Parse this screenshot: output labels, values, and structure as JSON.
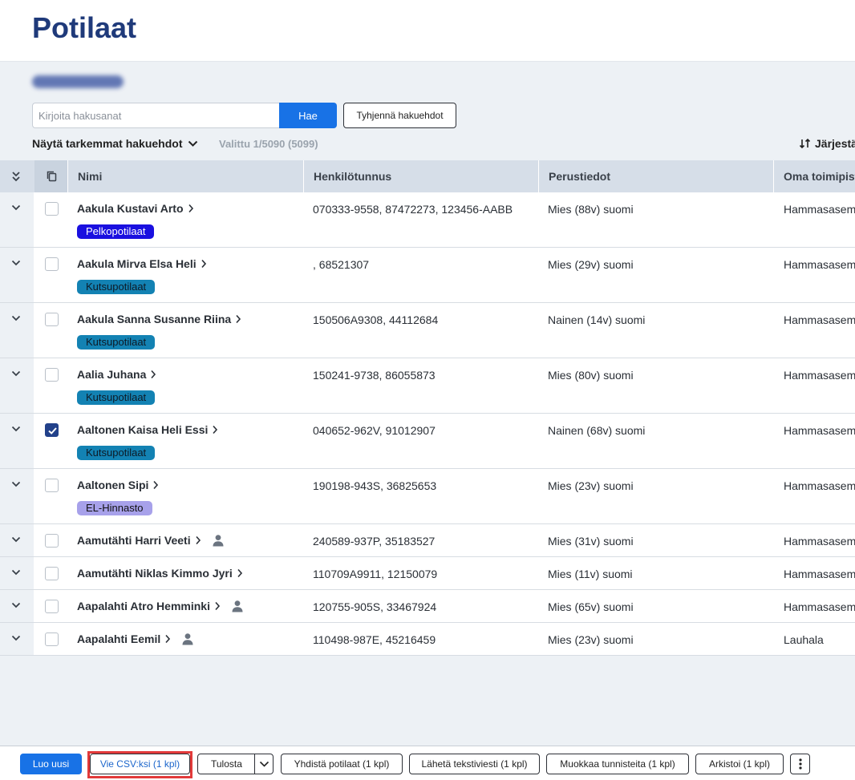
{
  "page": {
    "title": "Potilaat"
  },
  "search": {
    "placeholder": "Kirjoita hakusanat",
    "value": "",
    "search_label": "Hae",
    "clear_label": "Tyhjennä hakuehdot"
  },
  "filters": {
    "more_label": "Näytä tarkemmat hakuehdot",
    "selected_count": "Valittu 1/5090 (5099)",
    "sort_label": "Järjestä"
  },
  "table": {
    "headers": {
      "name": "Nimi",
      "hetu": "Henkilötunnus",
      "basic": "Perustiedot",
      "office": "Oma toimipiste"
    },
    "rows": [
      {
        "name": "Aakula Kustavi Arto",
        "hetu": "070333-9558, 87472273, 123456-AABB",
        "basic": "Mies (88v) suomi",
        "office": "Hammasasema",
        "tag": "Pelkopotilaat",
        "tag_style": "pelko",
        "checked": false,
        "person": false
      },
      {
        "name": "Aakula Mirva Elsa Heli",
        "hetu": ", 68521307",
        "basic": "Mies (29v) suomi",
        "office": "Hammasasema",
        "tag": "Kutsupotilaat",
        "tag_style": "kutsu",
        "checked": false,
        "person": false
      },
      {
        "name": "Aakula Sanna Susanne Riina",
        "hetu": "150506A9308, 44112684",
        "basic": "Nainen (14v) suomi",
        "office": "Hammasasema",
        "tag": "Kutsupotilaat",
        "tag_style": "kutsu",
        "checked": false,
        "person": false
      },
      {
        "name": "Aalia Juhana",
        "hetu": "150241-9738, 86055873",
        "basic": "Mies (80v) suomi",
        "office": "Hammasasema",
        "tag": "Kutsupotilaat",
        "tag_style": "kutsu",
        "checked": false,
        "person": false
      },
      {
        "name": "Aaltonen Kaisa Heli Essi",
        "hetu": "040652-962V, 91012907",
        "basic": "Nainen (68v) suomi",
        "office": "Hammasasema",
        "tag": "Kutsupotilaat",
        "tag_style": "kutsu",
        "checked": true,
        "person": false
      },
      {
        "name": "Aaltonen Sipi",
        "hetu": "190198-943S, 36825653",
        "basic": "Mies (23v) suomi",
        "office": "Hammasasema",
        "tag": "EL-Hinnasto",
        "tag_style": "el",
        "checked": false,
        "person": false
      },
      {
        "name": "Aamutähti Harri Veeti",
        "hetu": "240589-937P, 35183527",
        "basic": "Mies (31v) suomi",
        "office": "Hammasasema",
        "tag": "",
        "tag_style": "",
        "checked": false,
        "person": true
      },
      {
        "name": "Aamutähti Niklas Kimmo Jyri",
        "hetu": "110709A9911, 12150079",
        "basic": "Mies (11v) suomi",
        "office": "Hammasasema",
        "tag": "",
        "tag_style": "",
        "checked": false,
        "person": false
      },
      {
        "name": "Aapalahti Atro Hemminki",
        "hetu": "120755-905S, 33467924",
        "basic": "Mies (65v) suomi",
        "office": "Hammasasema",
        "tag": "",
        "tag_style": "",
        "checked": false,
        "person": true
      },
      {
        "name": "Aapalahti Eemil",
        "hetu": "110498-987E, 45216459",
        "basic": "Mies (23v) suomi",
        "office": "Lauhala",
        "tag": "",
        "tag_style": "",
        "checked": false,
        "person": true
      }
    ]
  },
  "actions": {
    "new": "Luo uusi",
    "csv": "Vie CSV:ksi (1 kpl)",
    "print": "Tulosta",
    "merge": "Yhdistä potilaat (1 kpl)",
    "sms": "Lähetä tekstiviesti (1 kpl)",
    "edit_ids": "Muokkaa tunnisteita (1 kpl)",
    "archive": "Arkistoi (1 kpl)"
  },
  "colors": {
    "title": "#1f3a7a",
    "primary": "#1872e6",
    "tag_pelko": "#1a10e0",
    "tag_kutsu": "#1382b3",
    "tag_el": "#a7a1ea",
    "highlight": "#e23a3a"
  },
  "icons": {
    "expand_all": "double-chevron-down-icon",
    "select_all": "copy-icon",
    "expand_row": "chevron-down-icon",
    "name_link": "chevron-right-icon",
    "person": "person-icon",
    "sort": "sort-arrows-icon",
    "more": "vertical-dots-icon"
  }
}
